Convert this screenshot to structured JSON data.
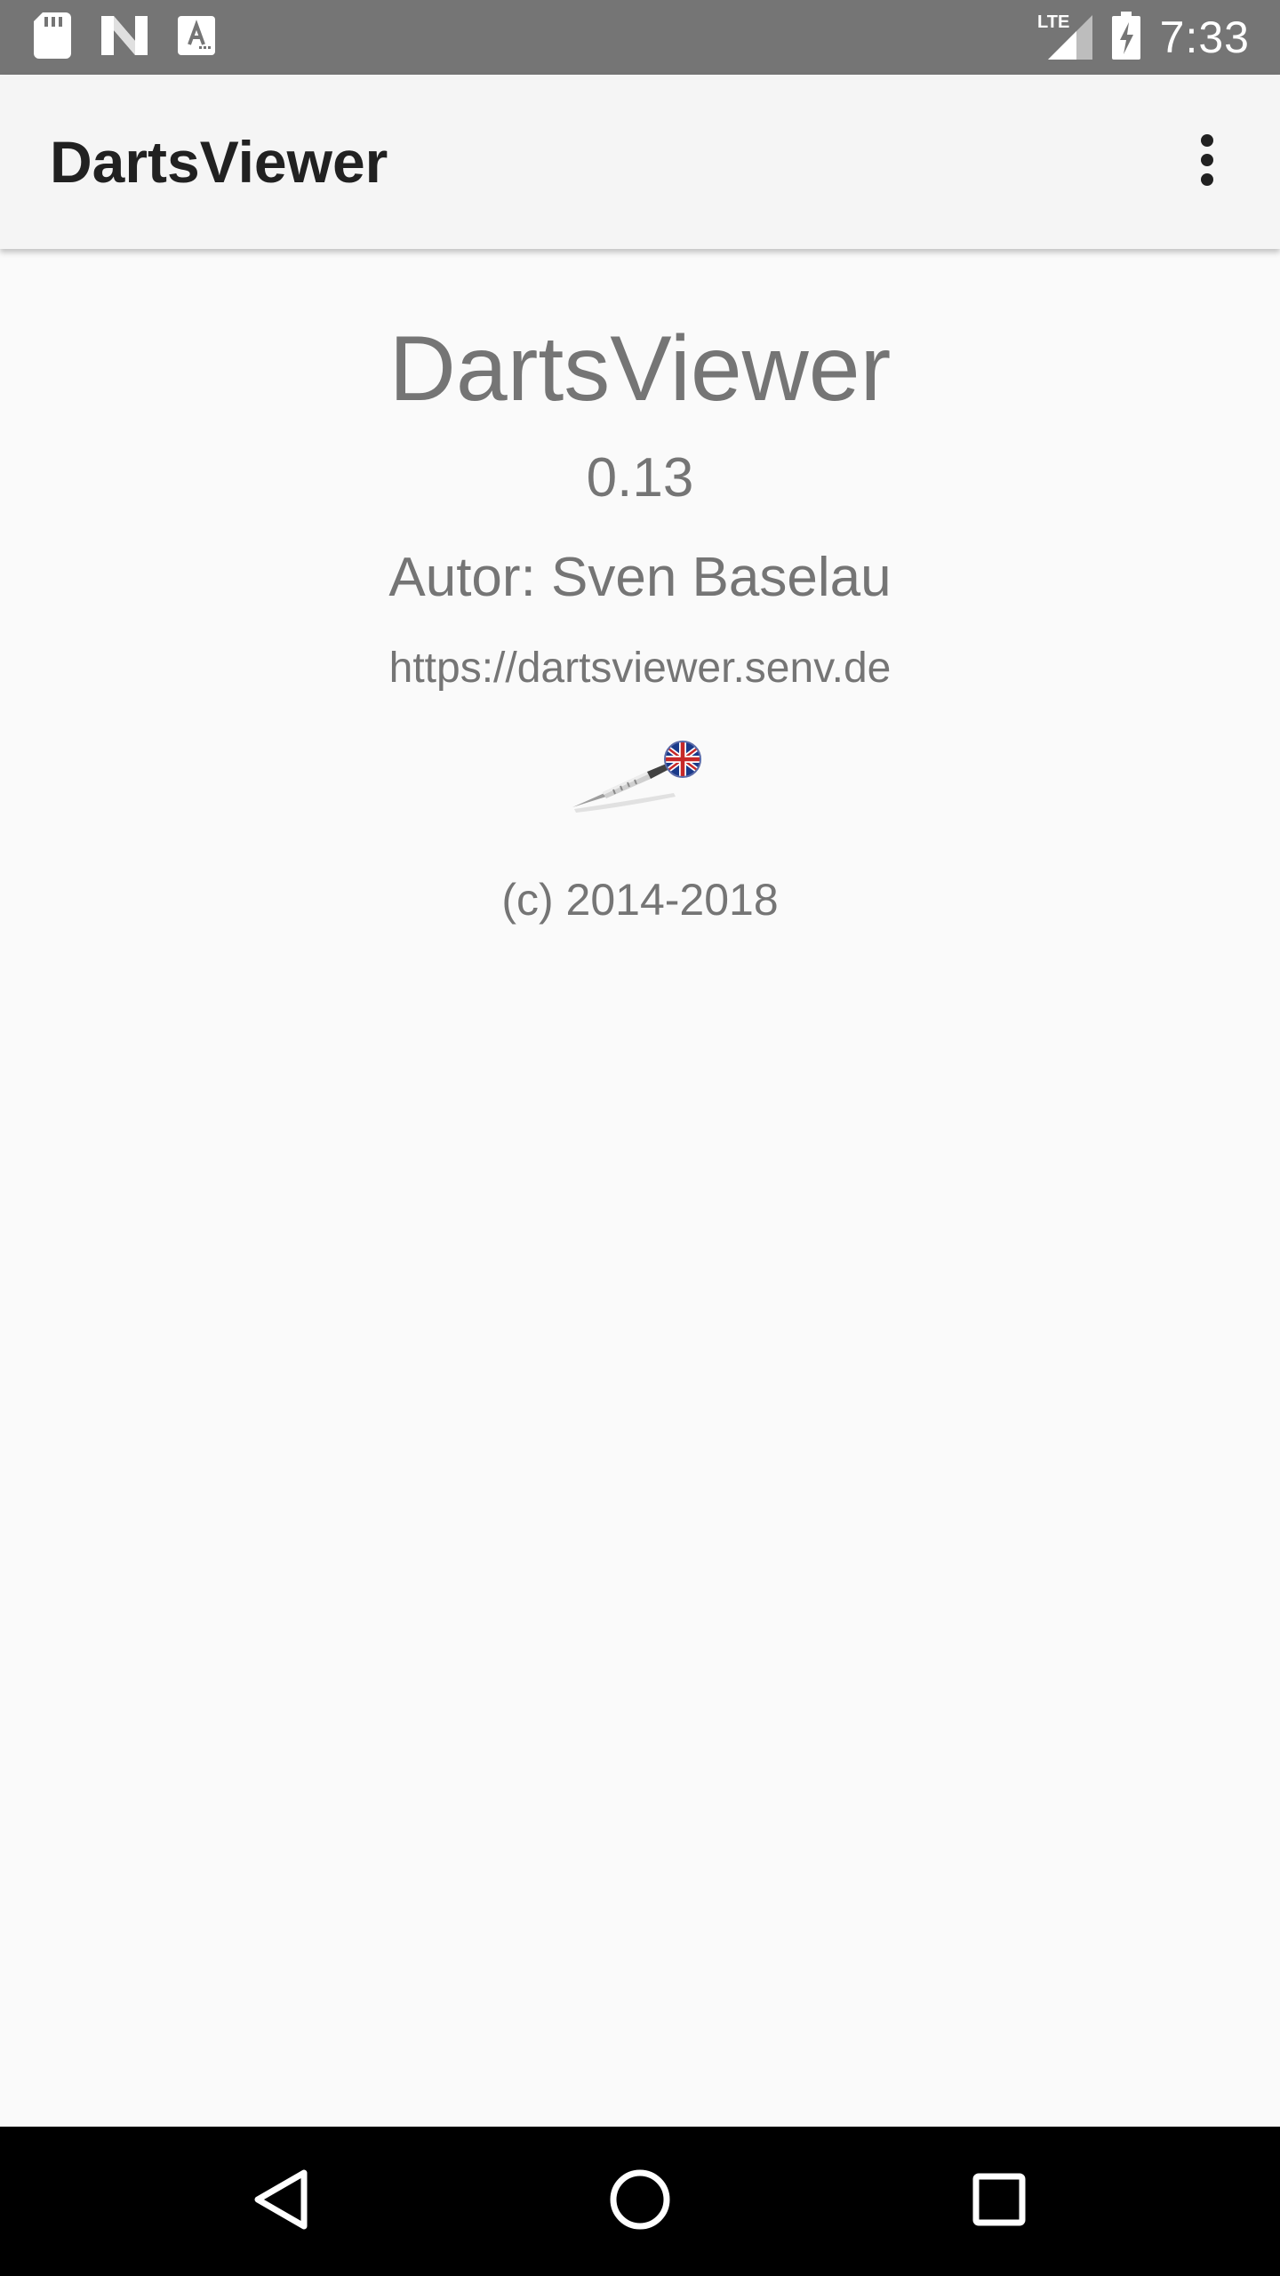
{
  "status_bar": {
    "time": "7:33",
    "network": "LTE",
    "icons_left": [
      "sd-card-icon",
      "n-logo-icon",
      "font-a-icon"
    ],
    "icons_right": [
      "lte-signal-icon",
      "battery-charging-icon"
    ]
  },
  "app_bar": {
    "title": "DartsViewer",
    "overflow_icon": "more-vert-icon"
  },
  "about": {
    "app_name": "DartsViewer",
    "version": "0.13",
    "author": "Autor: Sven Baselau",
    "website": "https://dartsviewer.senv.de",
    "image": "dart-icon",
    "copyright": "(c) 2014-2018"
  },
  "nav_bar": {
    "buttons": [
      "back-icon",
      "home-icon",
      "recents-icon"
    ]
  },
  "colors": {
    "status_bar_bg": "#757575",
    "app_bar_bg": "#f5f5f5",
    "content_bg": "#fafafa",
    "text_secondary": "#757575",
    "title_text": "#212121",
    "nav_bar_bg": "#000000"
  }
}
